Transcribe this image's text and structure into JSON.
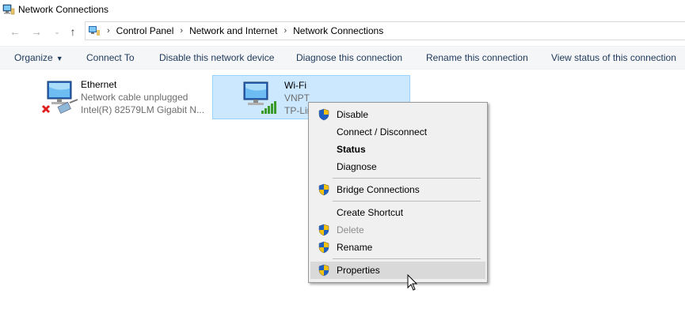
{
  "window": {
    "title": "Network Connections"
  },
  "nav": {
    "back_icon": "back-arrow-icon",
    "forward_icon": "forward-arrow-icon",
    "recent_icon": "chevron-down-icon",
    "up_icon": "up-arrow-icon"
  },
  "address": {
    "crumbs": [
      "Control Panel",
      "Network and Internet",
      "Network Connections"
    ]
  },
  "toolbar": {
    "organize": "Organize",
    "connect_to": "Connect To",
    "disable": "Disable this network device",
    "diagnose": "Diagnose this connection",
    "rename": "Rename this connection",
    "view_status": "View status of this connection"
  },
  "connections": [
    {
      "name": "Ethernet",
      "status": "Network cable unplugged",
      "device": "Intel(R) 82579LM Gigabit N..."
    },
    {
      "name": "Wi-Fi",
      "status": "VNPT",
      "device": "TP-Lin"
    }
  ],
  "context_menu": {
    "items": [
      {
        "label": "Disable",
        "shield": true
      },
      {
        "label": "Connect / Disconnect",
        "shield": false
      },
      {
        "label": "Status",
        "shield": false,
        "bold": true
      },
      {
        "label": "Diagnose",
        "shield": false
      },
      {
        "label": "Bridge Connections",
        "shield": true
      },
      {
        "label": "Create Shortcut",
        "shield": false
      },
      {
        "label": "Delete",
        "shield": true,
        "disabled": true
      },
      {
        "label": "Rename",
        "shield": true
      },
      {
        "label": "Properties",
        "shield": true,
        "highlighted": true
      }
    ]
  },
  "colors": {
    "selection_bg": "#cce8ff",
    "selection_border": "#99d1ff",
    "toolbar_text": "#1e395b",
    "menu_bg": "#f0f0f0",
    "menu_hover": "#d9d9d9"
  }
}
